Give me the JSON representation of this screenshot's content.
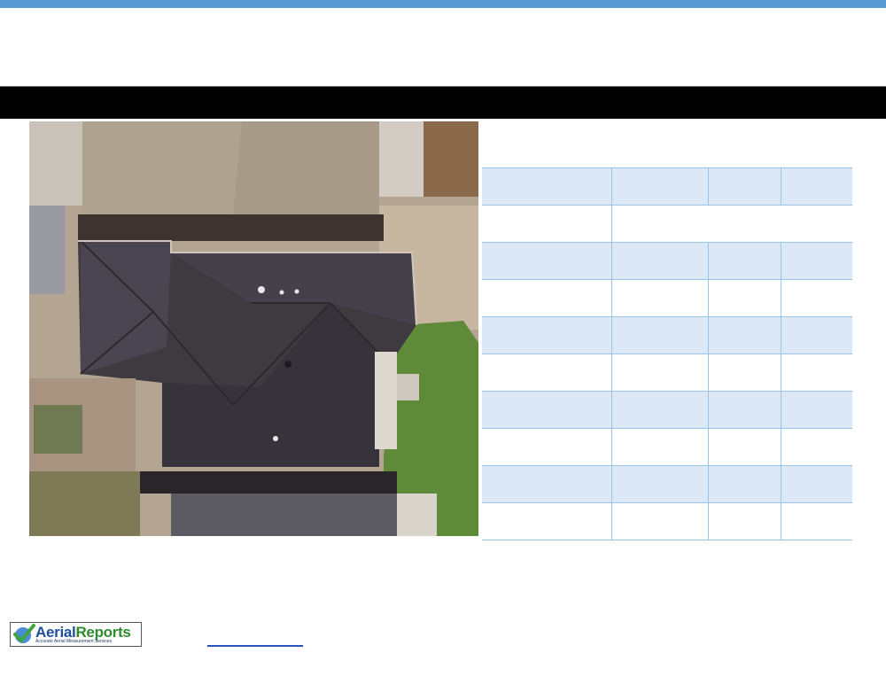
{
  "header": {
    "accent_color": "#5b9bd5",
    "title": ""
  },
  "image": {
    "description_icon": "aerial-photo"
  },
  "table": {
    "rows": [
      [
        "",
        "",
        "",
        ""
      ],
      [
        "",
        ""
      ],
      [
        "",
        "",
        "",
        ""
      ],
      [
        "",
        "",
        "",
        ""
      ],
      [
        "",
        "",
        "",
        ""
      ],
      [
        "",
        "",
        "",
        ""
      ],
      [
        "",
        "",
        "",
        ""
      ],
      [
        "",
        "",
        "",
        ""
      ],
      [
        "",
        "",
        "",
        ""
      ],
      [
        "",
        "",
        "",
        ""
      ]
    ]
  },
  "footer": {
    "logo_text_part1": "Aerial",
    "logo_text_part2": "Reports",
    "logo_tagline": "Accurate Aerial Measurement Services",
    "link_text": ""
  }
}
